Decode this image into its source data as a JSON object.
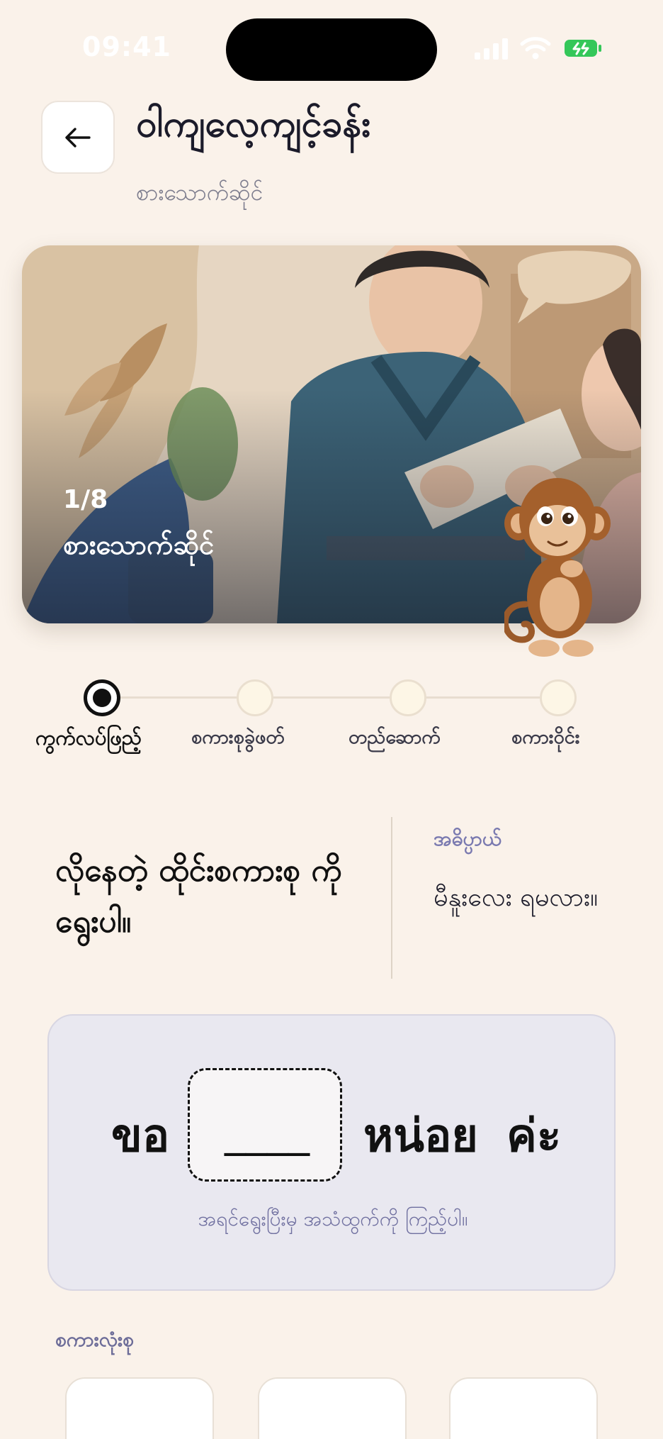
{
  "status_bar": {
    "time": "09:41",
    "icons": [
      "signal-icon",
      "wifi-icon",
      "battery-icon"
    ],
    "battery_color": "#34c759"
  },
  "header": {
    "back_icon": "arrow-left-icon",
    "title": "ဝါကျလေ့ကျင့်ခန်း",
    "subtitle": "စားသောက်ဆိုင်"
  },
  "hero": {
    "counter": "1/8",
    "title": "စားသောက်ဆိုင်",
    "image": "restaurant-waitress-illustration",
    "mascot": "monkey-mascot"
  },
  "stepper": {
    "steps": [
      {
        "label": "ကွက်လပ်ဖြည့်",
        "active": true
      },
      {
        "label": "စကားစုခွဲဖတ်",
        "active": false
      },
      {
        "label": "တည်ဆောက်",
        "active": false
      },
      {
        "label": "စကားဝိုင်း",
        "active": false
      }
    ]
  },
  "exercise": {
    "prompt": "လိုနေတဲ့ ထိုင်းစကားစု ကို ရွေးပါ။",
    "meaning_label": "အဓိပ္ပာယ်",
    "meaning": "မီနူးလေး ရမလား။"
  },
  "sentence": {
    "word_before": "ขอ",
    "blank": "____",
    "word_after_1": "หน่อย",
    "word_after_2": "ค่ะ",
    "hint": "အရင်ရွေးပြီးမှ အသံထွက်ကို ကြည့်ပါ။"
  },
  "word_bank": {
    "label": "စကားလုံးစု"
  },
  "colors": {
    "background": "#faf2ea",
    "accent": "#7a7ab0",
    "card": "#e9e8f0"
  }
}
